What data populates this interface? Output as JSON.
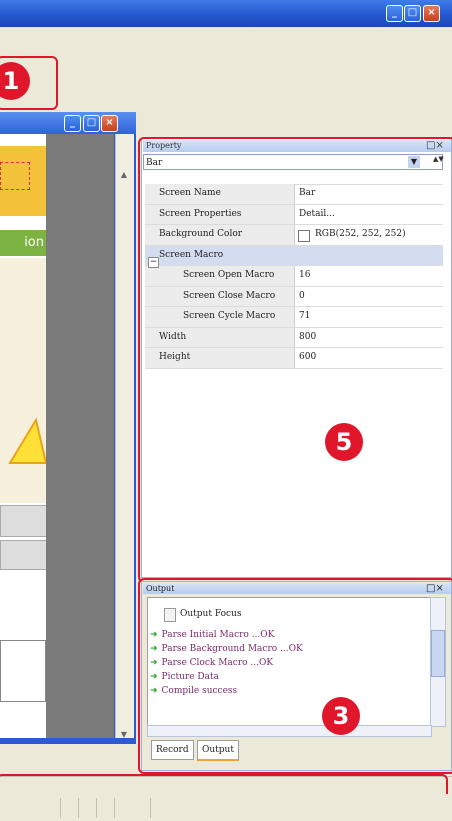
{
  "window": {
    "minimize_glyph": "_",
    "maximize_glyph": "□",
    "close_glyph": "×"
  },
  "callouts": {
    "c1": "1",
    "c5": "5",
    "c3": "3"
  },
  "editor": {
    "banner_text": "ion"
  },
  "property_panel": {
    "title": "Property",
    "selected": "Bar",
    "rows": [
      {
        "name": "Screen Name",
        "value": "Bar"
      },
      {
        "name": "Screen Properties",
        "value": "Detail..."
      },
      {
        "name": "Background Color",
        "value": "RGB(252, 252, 252)"
      },
      {
        "name": "Screen Macro",
        "value": ""
      },
      {
        "name": "Screen Open Macro",
        "value": "16"
      },
      {
        "name": "Screen Close Macro",
        "value": "0"
      },
      {
        "name": "Screen Cycle Macro",
        "value": "71"
      },
      {
        "name": "Width",
        "value": "800"
      },
      {
        "name": "Height",
        "value": "600"
      }
    ]
  },
  "output_panel": {
    "title": "Output",
    "header": "Output Focus",
    "lines": [
      "Parse Initial Macro ...OK",
      "Parse Background Macro ...OK",
      "Parse Clock Macro ...OK",
      "Picture Data",
      "Compile success"
    ],
    "tabs": [
      "Record",
      "Output"
    ]
  },
  "colors": {
    "callout_red": "#e0162b",
    "titlebar_blue": "#2458cf",
    "output_text": "#7a2a6c",
    "ok_arrow": "#2aa32a"
  }
}
